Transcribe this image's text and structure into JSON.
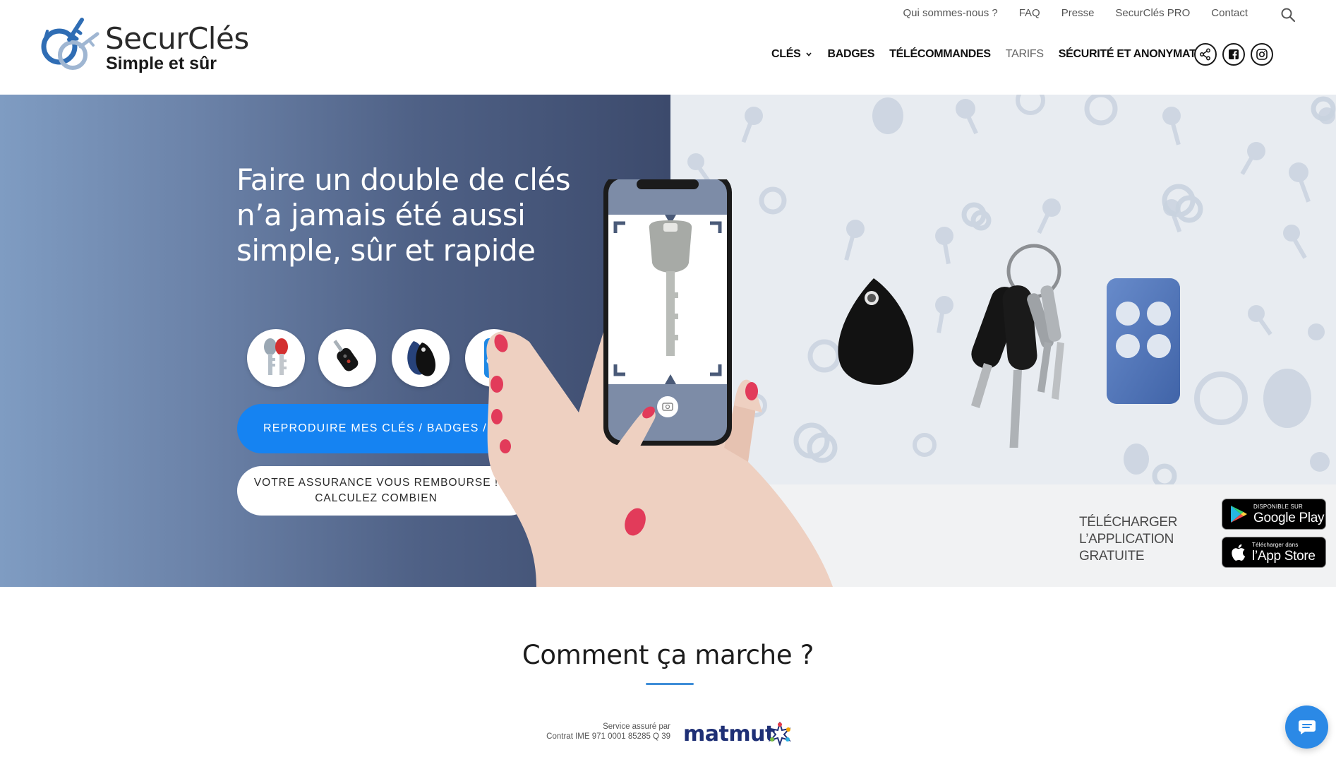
{
  "brand": {
    "name": "SecurClés",
    "tagline": "Simple et sûr"
  },
  "top_nav": [
    {
      "label": "Qui sommes-nous ?"
    },
    {
      "label": "FAQ"
    },
    {
      "label": "Presse"
    },
    {
      "label": "SecurClés PRO"
    },
    {
      "label": "Contact"
    }
  ],
  "main_nav": [
    {
      "label": "CLÉS",
      "has_dropdown": true
    },
    {
      "label": "BADGES"
    },
    {
      "label": "TÉLÉCOMMANDES"
    },
    {
      "label": "TARIFS"
    },
    {
      "label": "SÉCURITÉ ET ANONYMAT"
    }
  ],
  "social_icons": [
    "share-icon",
    "facebook-icon",
    "instagram-icon"
  ],
  "hero": {
    "title": "Faire un double de clés n’a jamais été aussi simple, sûr et rapide",
    "category_icons": [
      "keys-icon",
      "car-key-icon",
      "badge-icon",
      "remote-icon"
    ],
    "primary_button": "REPRODUIRE MES CLÉS / BADGES / BIPS",
    "secondary_button_line1": "VOTRE ASSURANCE VOUS REMBOURSE !",
    "secondary_button_line2": "CALCULEZ COMBIEN",
    "download_line1": "TÉLÉCHARGER",
    "download_line2": "L’APPLICATION",
    "download_line3": "GRATUITE",
    "google_play_small": "DISPONIBLE SUR",
    "google_play_big": "Google Play",
    "app_store_small": "Télécharger dans",
    "app_store_big": "l’App Store"
  },
  "section": {
    "title": "Comment ça marche ?"
  },
  "partner": {
    "line1": "Service assuré par",
    "line2": "Contrat IME 971 0001 85285 Q 39",
    "logo_text": "matmut"
  },
  "colors": {
    "primary_button": "#1583f2",
    "accent_rule": "#3f8ed8",
    "chat_button": "#2b89e6",
    "partner_brand": "#1e2f75"
  }
}
